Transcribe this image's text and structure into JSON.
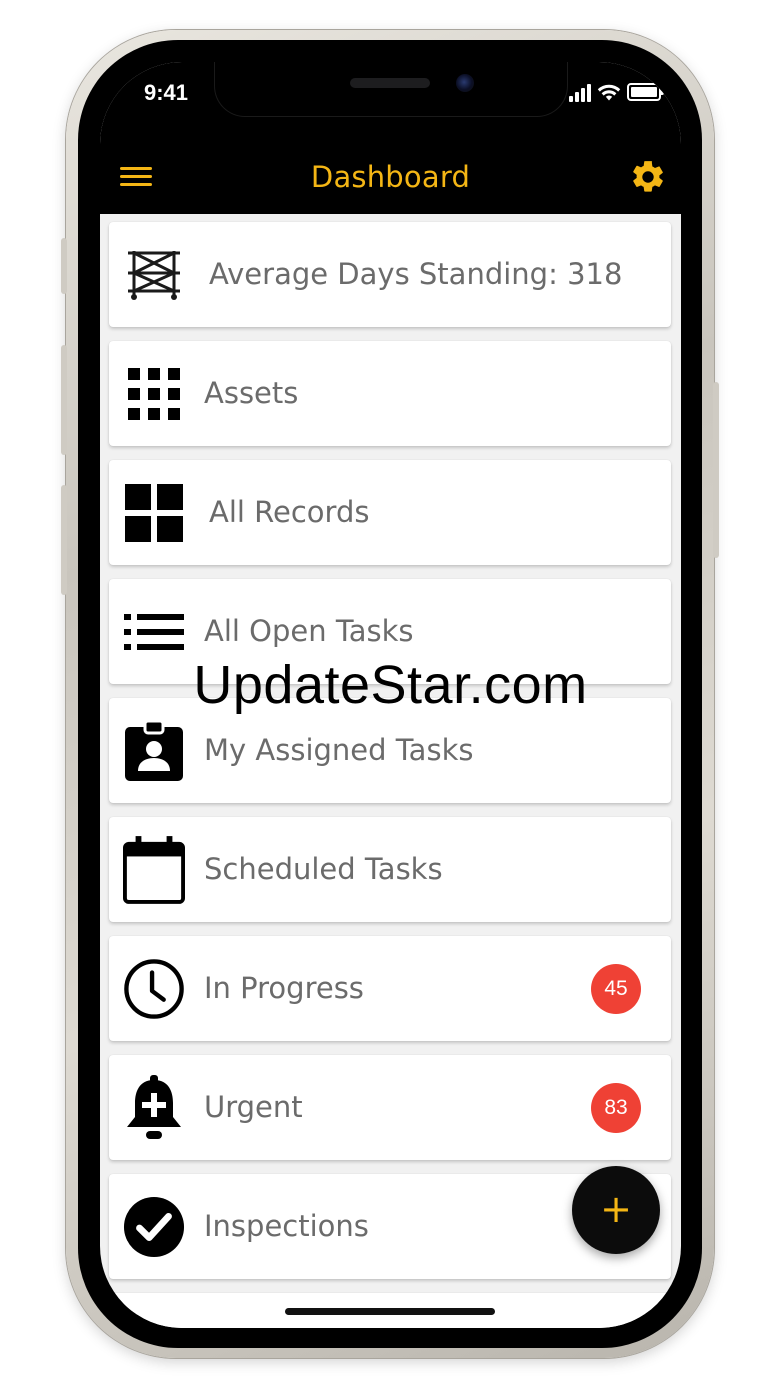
{
  "status_bar": {
    "time": "9:41",
    "icons": [
      "signal-icon",
      "wifi-icon",
      "battery-icon"
    ]
  },
  "header": {
    "title": "Dashboard",
    "menu_icon": "hamburger-menu-icon",
    "settings_icon": "gear-icon",
    "accent_color": "#f4b615",
    "background_color": "#000000"
  },
  "dashboard_items": [
    {
      "label": "Average Days Standing: 318",
      "icon": "scaffold-icon",
      "badge": ""
    },
    {
      "label": "Assets",
      "icon": "grid-dots-icon",
      "badge": ""
    },
    {
      "label": "All Records",
      "icon": "four-squares-icon",
      "badge": ""
    },
    {
      "label": "All Open Tasks",
      "icon": "list-icon",
      "badge": ""
    },
    {
      "label": "My Assigned Tasks",
      "icon": "id-badge-icon",
      "badge": ""
    },
    {
      "label": "Scheduled Tasks",
      "icon": "calendar-icon",
      "badge": ""
    },
    {
      "label": "In Progress",
      "icon": "clock-icon",
      "badge": "45"
    },
    {
      "label": "Urgent",
      "icon": "bell-plus-icon",
      "badge": "83"
    },
    {
      "label": "Inspections",
      "icon": "check-circle-icon",
      "badge": ""
    }
  ],
  "badge_color": "#ef4135",
  "watermark": "UpdateStar.com",
  "fab": {
    "label": "+",
    "icon": "plus-icon"
  }
}
